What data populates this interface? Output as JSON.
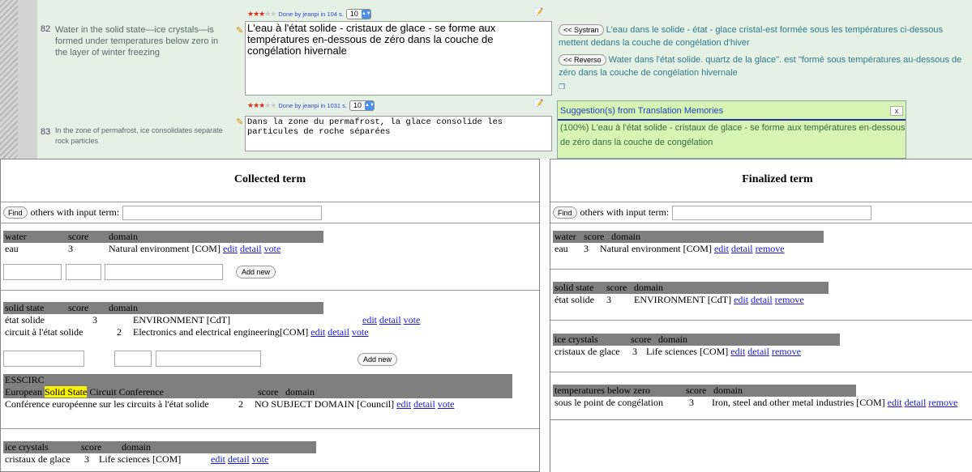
{
  "segments": [
    {
      "num": "82",
      "source": "Water in the solid state—ice crystals—is formed under temperatures below zero in the layer of winter freezing",
      "meta_text": "Done by jeanpi in 104 s.",
      "select_value": "10",
      "target": "L'eau à l'état solide -  cristaux de glace - se forme aux températures en-dessous de zéro dans la couche de congélation hivernale",
      "systran_btn": "<< Systran",
      "systran_text": "L'eau dans le solide - état - glace cristal-est formée sous les températures ci-dessous mettent dedans la couche de congélation d'hiver",
      "reverso_btn": "<< Reverso",
      "reverso_text": "Water dans l'état solide. quartz de la glace\". est \"formé sous températures au-dessous de zéro dans la couche de congélation hivernale"
    },
    {
      "num": "83",
      "source": "In the zone of permafrost, ice consolidates separate rock particles",
      "meta_text": "Done by jeanpi in 1031 s.",
      "select_value": "10",
      "target": "Dans la zone du permafrost, la glace consolide les particules de roche séparées"
    }
  ],
  "suggestion": {
    "title": "Suggestion(s) from Translation Memories",
    "close": "x",
    "text": "(100%) L'eau à l'état solide - cristaux de glace - se forme aux températures en-dessous de zéro dans la couche de congélation"
  },
  "collected": {
    "title": "Collected term",
    "find_btn": "Find",
    "find_label": "others with input term:",
    "add_new": "Add new",
    "score_h": "score",
    "domain_h": "domain",
    "edit": "edit",
    "detail": "detail",
    "vote": "vote",
    "b1": {
      "term": "water",
      "rows": [
        {
          "t": "eau",
          "s": "3",
          "d": "Natural environment [COM]"
        }
      ]
    },
    "b2": {
      "term": "solid state",
      "rows": [
        {
          "t": "état solide",
          "s": "3",
          "d": "ENVIRONMENT [CdT]"
        },
        {
          "t": "circuit à l'état solide",
          "s": "2",
          "d": "Electronics and electrical engineering[COM]"
        }
      ]
    },
    "b3": {
      "term": "ESSCIRC",
      "full_pre": "European ",
      "full_hl": "Solid State",
      "full_post": " Circuit Conference",
      "rows": [
        {
          "t": "Conférence européenne sur les circuits à l'état solide",
          "s": "2",
          "d": "NO SUBJECT DOMAIN [Council]"
        }
      ]
    },
    "b4": {
      "term": "ice crystals",
      "rows": [
        {
          "t": "cristaux de glace",
          "s": "3",
          "d": "Life sciences [COM]"
        }
      ]
    }
  },
  "finalized": {
    "title": "Finalized term",
    "find_btn": "Find",
    "find_label": "others with input term:",
    "score_h": "score",
    "domain_h": "domain",
    "edit": "edit",
    "detail": "detail",
    "remove": "remove",
    "b1": {
      "term": "water",
      "rows": [
        {
          "t": "eau",
          "s": "3",
          "d": "Natural environment [COM]"
        }
      ]
    },
    "b2": {
      "term": "solid state",
      "rows": [
        {
          "t": "état solide",
          "s": "3",
          "d": "ENVIRONMENT [CdT]"
        }
      ]
    },
    "b3": {
      "term": "ice crystals",
      "rows": [
        {
          "t": "cristaux de glace",
          "s": "3",
          "d": "Life sciences [COM]"
        }
      ]
    },
    "b4": {
      "term": "temperatures below zero",
      "rows": [
        {
          "t": "sous le point de congélation",
          "s": "3",
          "d": "Iron, steel and other metal industries [COM]"
        }
      ]
    }
  }
}
